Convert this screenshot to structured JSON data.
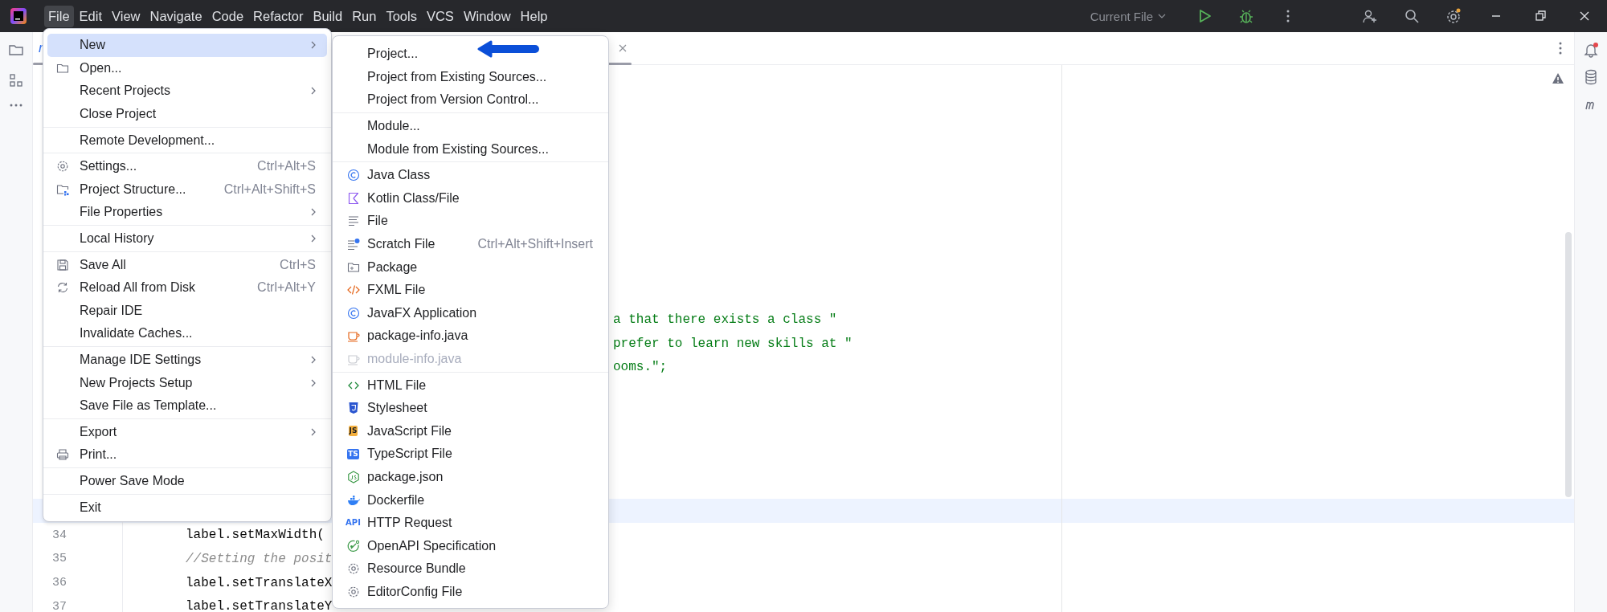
{
  "menu_bar": [
    {
      "label": "File",
      "selected": true
    },
    {
      "label": "Edit",
      "selected": false
    },
    {
      "label": "View",
      "selected": false
    },
    {
      "label": "Navigate",
      "selected": false
    },
    {
      "label": "Code",
      "selected": false
    },
    {
      "label": "Refactor",
      "selected": false
    },
    {
      "label": "Build",
      "selected": false
    },
    {
      "label": "Run",
      "selected": false
    },
    {
      "label": "Tools",
      "selected": false
    },
    {
      "label": "VCS",
      "selected": false
    },
    {
      "label": "Window",
      "selected": false
    },
    {
      "label": "Help",
      "selected": false
    }
  ],
  "toolbar": {
    "run_config": "Current File"
  },
  "editor": {
    "tab": {
      "label": "r"
    },
    "string_fragments": [
      "a that there exists a class \"",
      "prefer to learn new skills at \"",
      "ooms.\";"
    ],
    "numbered_lines": [
      {
        "number": "34",
        "code": "label.setMaxWidth(",
        "kind": "code"
      },
      {
        "number": "35",
        "code": "//Setting the posit",
        "kind": "comment"
      },
      {
        "number": "36",
        "code": "label.setTranslateX",
        "kind": "code"
      },
      {
        "number": "37",
        "code": "label.setTranslateY",
        "kind": "code"
      }
    ]
  },
  "file_menu": {
    "groups": [
      [
        {
          "label": "New",
          "submenu": true,
          "selected": true
        },
        {
          "label": "Open...",
          "submenu": false,
          "selected": false
        },
        {
          "label": "Recent Projects",
          "submenu": true,
          "selected": false
        },
        {
          "label": "Close Project",
          "submenu": false,
          "selected": false
        }
      ],
      [
        {
          "label": "Remote Development...",
          "submenu": false,
          "selected": false
        }
      ],
      [
        {
          "label": "Settings...",
          "shortcut": "Ctrl+Alt+S",
          "submenu": false,
          "selected": false
        },
        {
          "label": "Project Structure...",
          "shortcut": "Ctrl+Alt+Shift+S",
          "submenu": false,
          "selected": false
        },
        {
          "label": "File Properties",
          "submenu": true,
          "selected": false
        }
      ],
      [
        {
          "label": "Local History",
          "submenu": true,
          "selected": false
        }
      ],
      [
        {
          "label": "Save All",
          "shortcut": "Ctrl+S",
          "submenu": false,
          "selected": false
        },
        {
          "label": "Reload All from Disk",
          "shortcut": "Ctrl+Alt+Y",
          "submenu": false,
          "selected": false
        },
        {
          "label": "Repair IDE",
          "submenu": false,
          "selected": false
        },
        {
          "label": "Invalidate Caches...",
          "submenu": false,
          "selected": false
        }
      ],
      [
        {
          "label": "Manage IDE Settings",
          "submenu": true,
          "selected": false
        },
        {
          "label": "New Projects Setup",
          "submenu": true,
          "selected": false
        },
        {
          "label": "Save File as Template...",
          "submenu": false,
          "selected": false
        }
      ],
      [
        {
          "label": "Export",
          "submenu": true,
          "selected": false
        },
        {
          "label": "Print...",
          "submenu": false,
          "selected": false
        }
      ],
      [
        {
          "label": "Power Save Mode",
          "submenu": false,
          "selected": false
        }
      ],
      [
        {
          "label": "Exit",
          "submenu": false,
          "selected": false
        }
      ]
    ]
  },
  "new_submenu": {
    "groups": [
      [
        {
          "label": "Project...",
          "disabled": false
        },
        {
          "label": "Project from Existing Sources...",
          "disabled": false
        },
        {
          "label": "Project from Version Control...",
          "disabled": false
        }
      ],
      [
        {
          "label": "Module...",
          "disabled": false
        },
        {
          "label": "Module from Existing Sources...",
          "disabled": false
        }
      ],
      [
        {
          "label": "Java Class",
          "disabled": false
        },
        {
          "label": "Kotlin Class/File",
          "disabled": false
        },
        {
          "label": "File",
          "disabled": false
        },
        {
          "label": "Scratch File",
          "shortcut": "Ctrl+Alt+Shift+Insert",
          "disabled": false
        },
        {
          "label": "Package",
          "disabled": false
        },
        {
          "label": "FXML File",
          "disabled": false
        },
        {
          "label": "JavaFX Application",
          "disabled": false
        },
        {
          "label": "package-info.java",
          "disabled": false
        },
        {
          "label": "module-info.java",
          "disabled": true
        }
      ],
      [
        {
          "label": "HTML File",
          "disabled": false
        },
        {
          "label": "Stylesheet",
          "disabled": false
        },
        {
          "label": "JavaScript File",
          "badge": "JS",
          "disabled": false
        },
        {
          "label": "TypeScript File",
          "badge": "TS",
          "disabled": false
        },
        {
          "label": "package.json",
          "disabled": false
        },
        {
          "label": "Dockerfile",
          "disabled": false
        },
        {
          "label": "HTTP Request",
          "badge": "API",
          "disabled": false
        },
        {
          "label": "OpenAPI Specification",
          "disabled": false
        },
        {
          "label": "Resource Bundle",
          "disabled": false
        },
        {
          "label": "EditorConfig File",
          "disabled": false
        }
      ]
    ]
  }
}
